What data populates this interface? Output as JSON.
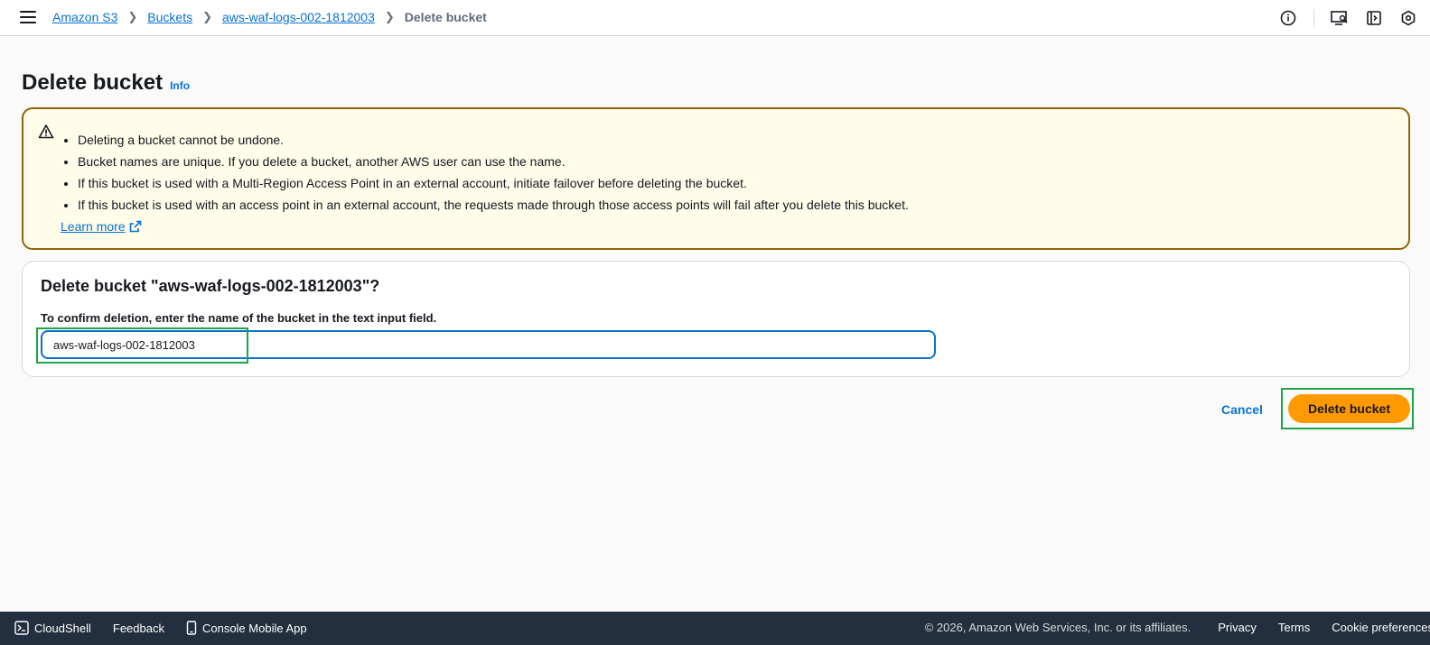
{
  "header": {
    "breadcrumbs": [
      "Amazon S3",
      "Buckets",
      "aws-waf-logs-002-1812003"
    ],
    "current_page": "Delete bucket",
    "icons": [
      "menu-icon",
      "info-circle-icon",
      "screen-search-icon",
      "console-panel-icon",
      "settings-hex-icon"
    ]
  },
  "page": {
    "title": "Delete bucket",
    "info_label": "Info"
  },
  "alert": {
    "type": "warning",
    "items": [
      "Deleting a bucket cannot be undone.",
      "Bucket names are unique. If you delete a bucket, another AWS user can use the name.",
      "If this bucket is used with a Multi-Region Access Point in an external account, initiate failover before deleting the bucket.",
      "If this bucket is used with an access point in an external account, the requests made through those access points will fail after you delete this bucket."
    ],
    "learn_more": "Learn more"
  },
  "confirm": {
    "title": "Delete bucket \"aws-waf-logs-002-1812003\"?",
    "label": "To confirm deletion, enter the name of the bucket in the text input field.",
    "input_value": "aws-waf-logs-002-1812003"
  },
  "actions": {
    "cancel": "Cancel",
    "delete": "Delete bucket"
  },
  "footer": {
    "cloudshell": "CloudShell",
    "feedback": "Feedback",
    "mobile_app": "Console Mobile App",
    "copyright": "© 2026, Amazon Web Services, Inc. or its affiliates.",
    "privacy": "Privacy",
    "terms": "Terms",
    "cookie": "Cookie preferences"
  },
  "colors": {
    "accent": "#0972d3",
    "primary_button": "#ff9900",
    "warning_border": "#8d6605",
    "warning_bg": "#fffce9",
    "footer_bg": "#232f3e",
    "highlight": "#1ea446"
  }
}
